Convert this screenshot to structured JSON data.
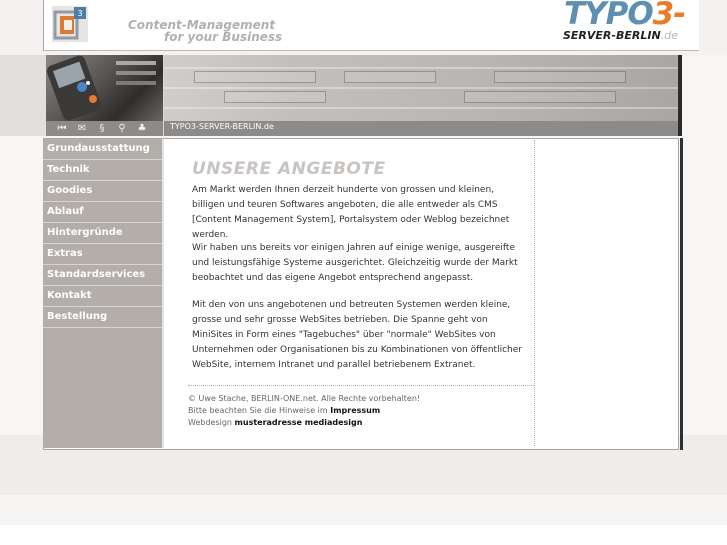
{
  "header": {
    "slogan_line1": "Content-Management",
    "slogan_line2": "for your Business",
    "brand_main": "TYPO",
    "brand_three": "3",
    "brand_dash": "-",
    "brand_server": "SERVER-BERLIN",
    "brand_tld": ".de"
  },
  "banner": {
    "url_label": "TYPO3-SERVER-BERLIN.de",
    "icons": [
      "home-icon",
      "mail-icon",
      "sitemap-icon",
      "search-icon",
      "tree-icon"
    ],
    "icon_glyphs": [
      "⏮",
      "✉",
      "§",
      "⚲",
      "♣"
    ]
  },
  "sidebar": {
    "items": [
      {
        "label": "Grundausstattung"
      },
      {
        "label": "Technik"
      },
      {
        "label": "Goodies"
      },
      {
        "label": "Ablauf"
      },
      {
        "label": "Hintergründe"
      },
      {
        "label": "Extras"
      },
      {
        "label": "Standardservices"
      },
      {
        "label": "Kontakt"
      },
      {
        "label": "Bestellung"
      }
    ]
  },
  "main": {
    "title": "UNSERE ANGEBOTE",
    "paragraphs": [
      "Am Markt werden Ihnen derzeit hunderte von grossen und kleinen, billigen und teuren Softwares angeboten, die alle entweder als CMS [Content Management System], Portalsystem oder Weblog bezeichnet werden.",
      "Wir haben uns bereits vor einigen Jahren auf einige wenige, ausgereifte und leistungsfähige Systeme ausgerichtet. Gleichzeitig wurde der Markt beobachtet und das eigene Angebot entsprechend angepasst.",
      "Mit den von uns angebotenen und betreuten Systemen werden kleine, grosse und sehr grosse WebSites betrieben. Die Spanne geht von MiniSites in Form eines \"Tagebuches\" über \"normale\" WebSites von Unternehmen oder Organisationen bis zu Kombinationen von öffentlicher WebSite, internem Intranet und parallel betriebenem Extranet."
    ]
  },
  "footer": {
    "copyright": "© Uwe Stache, BERLIN-ONE.net. Alle Rechte vorbehalten!",
    "notice_prefix": "Bitte beachten Sie die Hinweise im",
    "notice_link": "Impressum",
    "webdesign_prefix": "Webdesign",
    "webdesign_link": "musteradresse mediadesign"
  },
  "colors": {
    "brand_blue": "#5f8fb0",
    "brand_orange": "#e77d2a",
    "sidebar_bg": "#b3aeaa",
    "title_gray": "#c7c4c1"
  }
}
